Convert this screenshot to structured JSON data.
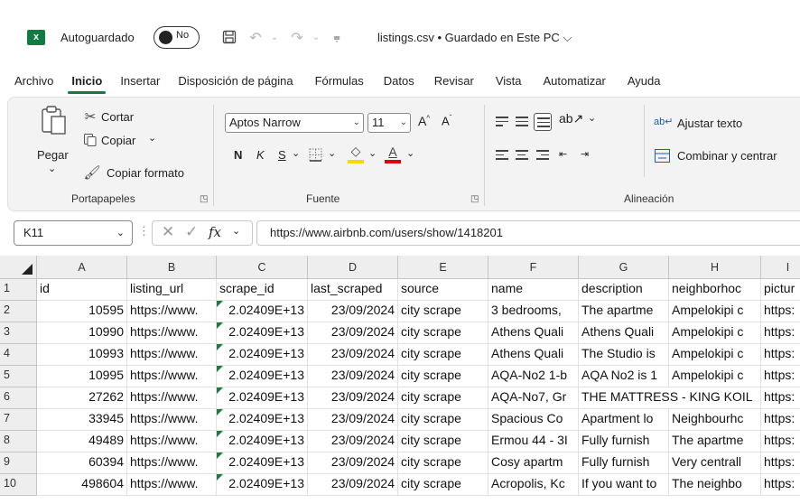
{
  "titlebar": {
    "app_icon": "excel-logo",
    "app_icon_text": "x",
    "autosave_label": "Autoguardado",
    "autosave_state": "No",
    "doc_title": "listings.csv • Guardado en Este PC",
    "doc_title_chevron": "⌵"
  },
  "tabs": [
    "Archivo",
    "Inicio",
    "Insertar",
    "Disposición de página",
    "Fórmulas",
    "Datos",
    "Revisar",
    "Vista",
    "Automatizar",
    "Ayuda"
  ],
  "active_tab": "Inicio",
  "ribbon": {
    "clipboard": {
      "paste": "Pegar",
      "cut": "Cortar",
      "copy": "Copiar",
      "format_painter": "Copiar formato",
      "group_label": "Portapapeles"
    },
    "font": {
      "font_name": "Aptos Narrow",
      "font_size": "11",
      "bold": "N",
      "italic": "K",
      "underline": "S",
      "group_label": "Fuente"
    },
    "alignment": {
      "wrap_text": "Ajustar texto",
      "merge_center": "Combinar y centrar",
      "group_label": "Alineación"
    }
  },
  "formula_bar": {
    "name_box": "K11",
    "fx": "fx",
    "formula": "https://www.airbnb.com/users/show/1418201"
  },
  "grid": {
    "columns": [
      "A",
      "B",
      "C",
      "D",
      "E",
      "F",
      "G",
      "H",
      "I"
    ],
    "rows": [
      {
        "n": "1",
        "cells": [
          "id",
          "listing_url",
          "scrape_id",
          "last_scraped",
          "source",
          "name",
          "description",
          "neighborhoc",
          "pictur"
        ]
      },
      {
        "n": "2",
        "cells": [
          "10595",
          "https://www.",
          "2.02409E+13",
          "23/09/2024",
          "city scrape",
          "3 bedrooms,",
          "The apartme",
          "Ampelokipi c",
          "https:"
        ]
      },
      {
        "n": "3",
        "cells": [
          "10990",
          "https://www.",
          "2.02409E+13",
          "23/09/2024",
          "city scrape",
          "Athens Quali",
          "Athens Quali",
          "Ampelokipi c",
          "https:"
        ]
      },
      {
        "n": "4",
        "cells": [
          "10993",
          "https://www.",
          "2.02409E+13",
          "23/09/2024",
          "city scrape",
          "Athens Quali",
          "The Studio is",
          "Ampelokipi c",
          "https:"
        ]
      },
      {
        "n": "5",
        "cells": [
          "10995",
          "https://www.",
          "2.02409E+13",
          "23/09/2024",
          "city scrape",
          "AQA-No2 1-b",
          "AQA No2 is 1",
          "Ampelokipi c",
          "https:"
        ]
      },
      {
        "n": "6",
        "cells": [
          "27262",
          "https://www.",
          "2.02409E+13",
          "23/09/2024",
          "city scrape",
          "AQA-No7, Gr",
          "THE MATTRESS - KING KOIL",
          "",
          "https:"
        ]
      },
      {
        "n": "7",
        "cells": [
          "33945",
          "https://www.",
          "2.02409E+13",
          "23/09/2024",
          "city scrape",
          "Spacious Co",
          "Apartment lo",
          "Neighbourhc",
          "https:"
        ]
      },
      {
        "n": "8",
        "cells": [
          "49489",
          "https://www.",
          "2.02409E+13",
          "23/09/2024",
          "city scrape",
          "Ermou 44 - 3I",
          "Fully furnish",
          "The apartme",
          "https:"
        ]
      },
      {
        "n": "9",
        "cells": [
          "60394",
          "https://www.",
          "2.02409E+13",
          "23/09/2024",
          "city scrape",
          "Cosy apartm",
          "Fully furnish",
          "Very centrall",
          "https:"
        ]
      },
      {
        "n": "10",
        "cells": [
          "498604",
          "https://www.",
          "2.02409E+13",
          "23/09/2024",
          "city scrape",
          "Acropolis, Kc",
          "If you want to",
          "The neighbo",
          "https:"
        ]
      }
    ]
  },
  "colors": {
    "excel_green": "#107c41",
    "font_highlight": "#ffd700",
    "font_color": "#e00000"
  }
}
